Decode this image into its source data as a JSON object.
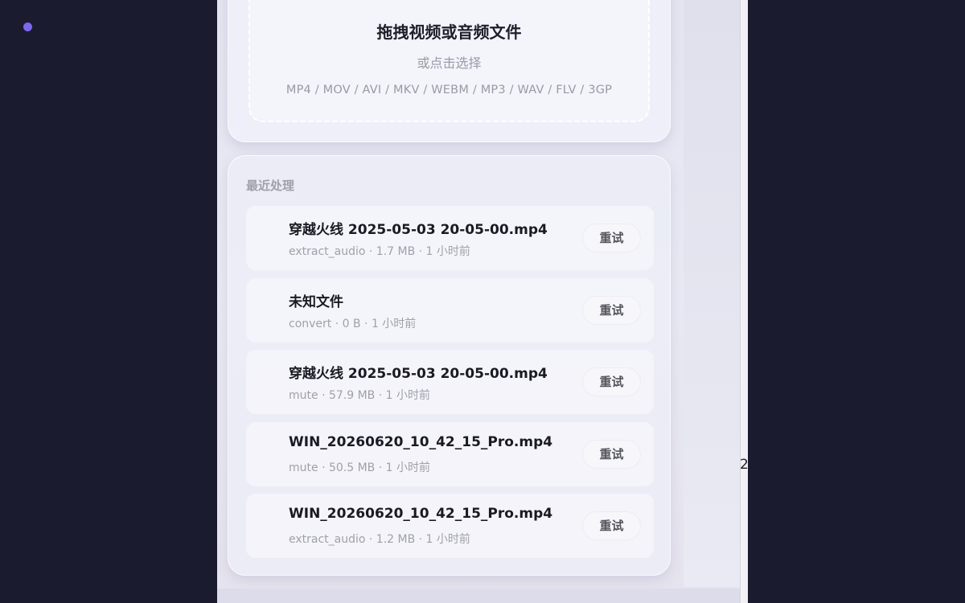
{
  "stray_text": "2",
  "upload": {
    "title": "拖拽视频或音频文件",
    "subtitle": "或点击选择",
    "formats": "MP4 / MOV / AVI / MKV / WEBM / MP3 / WAV / FLV / 3GP"
  },
  "recent": {
    "title": "最近处理",
    "retry_label": "重试",
    "items": [
      {
        "name": "穿越火线 2025-05-03 20-05-00.mp4",
        "meta": "extract_audio · 1.7 MB · 1 小时前"
      },
      {
        "name": "未知文件",
        "meta": "convert · 0 B · 1 小时前"
      },
      {
        "name": "穿越火线 2025-05-03 20-05-00.mp4",
        "meta": "mute · 57.9 MB · 1 小时前"
      },
      {
        "name": "WIN_20260620_10_42_15_Pro.mp4",
        "meta": "mute · 50.5 MB · 1 小时前"
      },
      {
        "name": "WIN_20260620_10_42_15_Pro.mp4",
        "meta": "extract_audio · 1.2 MB · 1 小时前"
      }
    ]
  },
  "colors": {
    "background": "#1b1b30",
    "status_dot": "#7b68ee",
    "panel": "#e6e7f1"
  }
}
